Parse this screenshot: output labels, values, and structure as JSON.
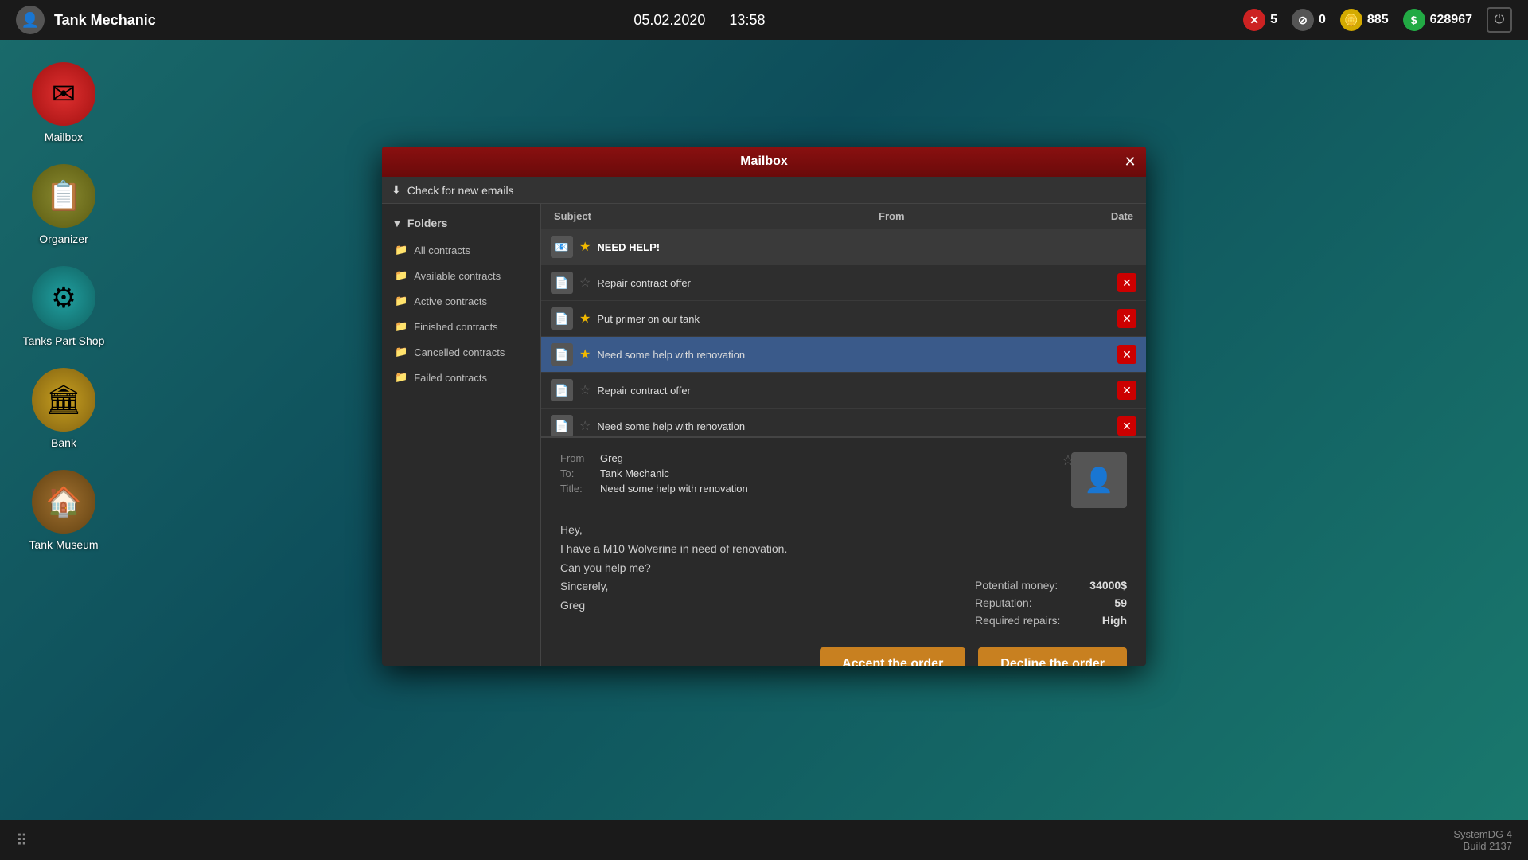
{
  "topbar": {
    "player_name": "Tank Mechanic",
    "date": "05.02.2020",
    "time": "13:58",
    "stat_alerts": "5",
    "stat_info": "0",
    "stat_coins": "885",
    "stat_money": "628967"
  },
  "sidebar": {
    "items": [
      {
        "id": "mailbox",
        "label": "Mailbox",
        "icon": "✉",
        "color": "icon-red"
      },
      {
        "id": "organizer",
        "label": "Organizer",
        "icon": "📋",
        "color": "icon-olive"
      },
      {
        "id": "tanks-part-shop",
        "label": "Tanks Part Shop",
        "icon": "⚙",
        "color": "icon-teal"
      },
      {
        "id": "bank",
        "label": "Bank",
        "icon": "🏛",
        "color": "icon-gold"
      },
      {
        "id": "tank-museum",
        "label": "Tank Museum",
        "icon": "🏠",
        "color": "icon-brown"
      }
    ]
  },
  "modal": {
    "title": "Mailbox",
    "check_emails_label": "Check for new emails",
    "folders_header": "Folders",
    "folders": [
      {
        "id": "all",
        "label": "All contracts"
      },
      {
        "id": "available",
        "label": "Available contracts"
      },
      {
        "id": "active",
        "label": "Active contracts"
      },
      {
        "id": "finished",
        "label": "Finished contracts"
      },
      {
        "id": "cancelled",
        "label": "Cancelled contracts"
      },
      {
        "id": "failed",
        "label": "Failed contracts"
      }
    ],
    "email_list_headers": {
      "subject": "Subject",
      "from": "From",
      "date": "Date"
    },
    "emails": [
      {
        "id": 1,
        "subject": "NEED HELP!",
        "from": "",
        "date": "",
        "starred": true,
        "type": "unread",
        "icon": "📧"
      },
      {
        "id": 2,
        "subject": "Repair contract offer",
        "from": "",
        "date": "",
        "starred": false,
        "type": "normal",
        "icon": "📄"
      },
      {
        "id": 3,
        "subject": "Put primer on our tank",
        "from": "",
        "date": "",
        "starred": true,
        "type": "normal",
        "icon": "📄"
      },
      {
        "id": 4,
        "subject": "Need some help with renovation",
        "from": "",
        "date": "",
        "starred": true,
        "type": "selected",
        "icon": "📄"
      },
      {
        "id": 5,
        "subject": "Repair contract offer",
        "from": "",
        "date": "",
        "starred": false,
        "type": "normal",
        "icon": "📄"
      },
      {
        "id": 6,
        "subject": "Need some help with renovation",
        "from": "",
        "date": "",
        "starred": false,
        "type": "normal",
        "icon": "📄"
      }
    ],
    "detail": {
      "from": "Greg",
      "to": "Tank Mechanic",
      "title": "Need some help with renovation",
      "body_line1": "Hey,",
      "body_line2": "I have a M10 Wolverine in need of renovation.",
      "body_line3": "Can you help me?",
      "body_line4": "Sincerely,",
      "body_line5": "Greg",
      "potential_money_label": "Potential money:",
      "potential_money_value": "34000$",
      "reputation_label": "Reputation:",
      "reputation_value": "59",
      "required_repairs_label": "Required repairs:",
      "required_repairs_value": "High",
      "accept_btn": "Accept the order",
      "decline_btn": "Decline the order"
    }
  },
  "bottombar": {
    "build_line1": "SystemDG 4",
    "build_line2": "Build 2137"
  }
}
